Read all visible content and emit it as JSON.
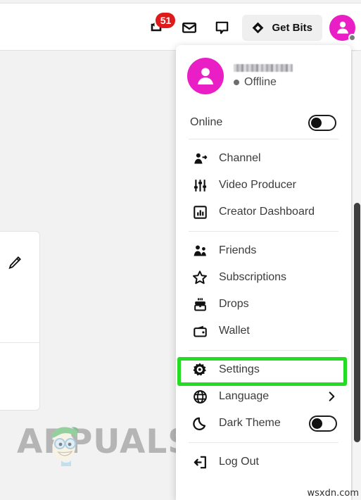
{
  "topbar": {
    "notifications": {
      "icon": "notifications-icon",
      "badge_count": "51"
    },
    "inbox": {
      "icon": "inbox-icon"
    },
    "whispers": {
      "icon": "speech-bubble-icon"
    },
    "get_bits": {
      "label": "Get Bits",
      "icon": "bits-diamond-icon"
    },
    "avatar": {
      "icon": "user-avatar-icon",
      "status": "offline"
    }
  },
  "menu": {
    "header": {
      "avatar_icon": "user-avatar-icon",
      "username": "",
      "username_redacted": true,
      "status": "Offline"
    },
    "online_row": {
      "label": "Online",
      "toggle_state": "off"
    },
    "groups": [
      {
        "items": [
          {
            "label": "Channel",
            "icon": "channel-person-icon"
          },
          {
            "label": "Video Producer",
            "icon": "sliders-icon"
          },
          {
            "label": "Creator Dashboard",
            "icon": "chart-box-icon"
          }
        ]
      },
      {
        "items": [
          {
            "label": "Friends",
            "icon": "friends-icon"
          },
          {
            "label": "Subscriptions",
            "icon": "star-icon"
          },
          {
            "label": "Drops",
            "icon": "drops-chest-icon"
          },
          {
            "label": "Wallet",
            "icon": "wallet-icon"
          }
        ]
      },
      {
        "items": [
          {
            "label": "Settings",
            "icon": "gear-icon",
            "highlighted": true
          },
          {
            "label": "Language",
            "icon": "globe-icon",
            "accessory": "chevron-right-icon"
          },
          {
            "label": "Dark Theme",
            "icon": "moon-icon",
            "toggle_state": "off"
          }
        ]
      },
      {
        "items": [
          {
            "label": "Log Out",
            "icon": "logout-icon"
          }
        ]
      }
    ]
  },
  "left_card": {
    "edit_icon": "pencil-icon"
  },
  "watermarks": {
    "appuals": "APPUALS",
    "site": "wsxdn.com"
  },
  "colors": {
    "accent_pink": "#e91ec4",
    "badge_red": "#e01a1a",
    "highlight_green": "#22dd22",
    "page_bg": "#f2f2f2"
  }
}
